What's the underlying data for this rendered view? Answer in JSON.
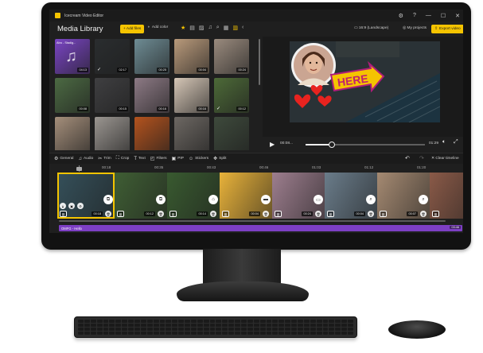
{
  "app": {
    "title": "Icecream Video Editor",
    "controls": {
      "settings": "⚙",
      "help": "?",
      "minimize": "—",
      "maximize": "☐",
      "close": "✕"
    }
  },
  "header": {
    "library_title": "Media Library",
    "add_files": "+ Add files",
    "add_color": "Add color",
    "aspect_ratio": "16:9 (Landscape)",
    "my_projects": "My projects",
    "export_video": "Export video"
  },
  "media": {
    "items": [
      {
        "name": "Atro - Stadig...",
        "duration": "04:13",
        "type": "audio",
        "checked": false,
        "color": "#7a45c4"
      },
      {
        "name": "",
        "duration": "02:17",
        "type": "video",
        "checked": true,
        "color": "#2a2d2f"
      },
      {
        "name": "",
        "duration": "00:25",
        "type": "video",
        "checked": false,
        "color": "#6e8c94"
      },
      {
        "name": "",
        "duration": "00:04",
        "type": "video",
        "checked": false,
        "color": "#b99a7b"
      },
      {
        "name": "",
        "duration": "00:24",
        "type": "video",
        "checked": false,
        "color": "#9a8b7e"
      },
      {
        "name": "",
        "duration": "00:08",
        "type": "video",
        "checked": false,
        "color": "#4c6a43"
      },
      {
        "name": "",
        "duration": "00:15",
        "type": "video",
        "checked": false,
        "color": "#3f3f41"
      },
      {
        "name": "",
        "duration": "00:16",
        "type": "video",
        "checked": false,
        "color": "#8d7a85"
      },
      {
        "name": "",
        "duration": "00:16",
        "type": "video",
        "checked": false,
        "color": "#d5c6b6"
      },
      {
        "name": "",
        "duration": "00:12",
        "type": "video",
        "checked": true,
        "color": "#4d6a38"
      },
      {
        "name": "",
        "duration": "",
        "type": "video",
        "checked": false,
        "color": "#a58f7b"
      },
      {
        "name": "",
        "duration": "",
        "type": "video",
        "checked": false,
        "color": "#9b9691"
      },
      {
        "name": "",
        "duration": "",
        "type": "video",
        "checked": false,
        "color": "#b4531e"
      },
      {
        "name": "",
        "duration": "",
        "type": "video",
        "checked": false,
        "color": "#6d6863"
      },
      {
        "name": "",
        "duration": "",
        "type": "video",
        "checked": false,
        "color": "#3e4a3c"
      }
    ]
  },
  "player": {
    "current_time": "00:08...",
    "total_time": "01:29",
    "sticker_text": "HERE",
    "progress_fraction": 0.22
  },
  "toolbar": {
    "tools": [
      {
        "icon": "⚙",
        "label": "General"
      },
      {
        "icon": "♫",
        "label": "Audio"
      },
      {
        "icon": "✂",
        "label": "Trim"
      },
      {
        "icon": "⛶",
        "label": "Crop"
      },
      {
        "icon": "T",
        "label": "Text"
      },
      {
        "icon": "◰",
        "label": "Filters"
      },
      {
        "icon": "▣",
        "label": "PIP"
      },
      {
        "icon": "☺",
        "label": "Stickers"
      },
      {
        "icon": "✥",
        "label": "Split"
      }
    ],
    "undo": "↶",
    "redo": "↷",
    "clear_timeline": "✕ Clear timeline"
  },
  "ruler": {
    "ticks": [
      "00:18",
      "00:35",
      "00:43",
      "00:46",
      "01:03",
      "01:12",
      "01:20"
    ]
  },
  "timeline": {
    "clips": [
      {
        "duration": "00:18",
        "color": "#35505a"
      },
      {
        "duration": "00:12",
        "color": "#3f5e34"
      },
      {
        "duration": "00:14",
        "color": "#395a30"
      },
      {
        "duration": "00:04",
        "color": "#e8b23a"
      },
      {
        "duration": "00:24",
        "color": "#9d7e8e"
      },
      {
        "duration": "00:04",
        "color": "#6a7c8a"
      },
      {
        "duration": "00:07",
        "color": "#a58a72"
      },
      {
        "duration": "",
        "color": "#8a5a48"
      }
    ]
  },
  "audio_track": {
    "label": "OMFG - Hello",
    "duration": "03:46"
  }
}
